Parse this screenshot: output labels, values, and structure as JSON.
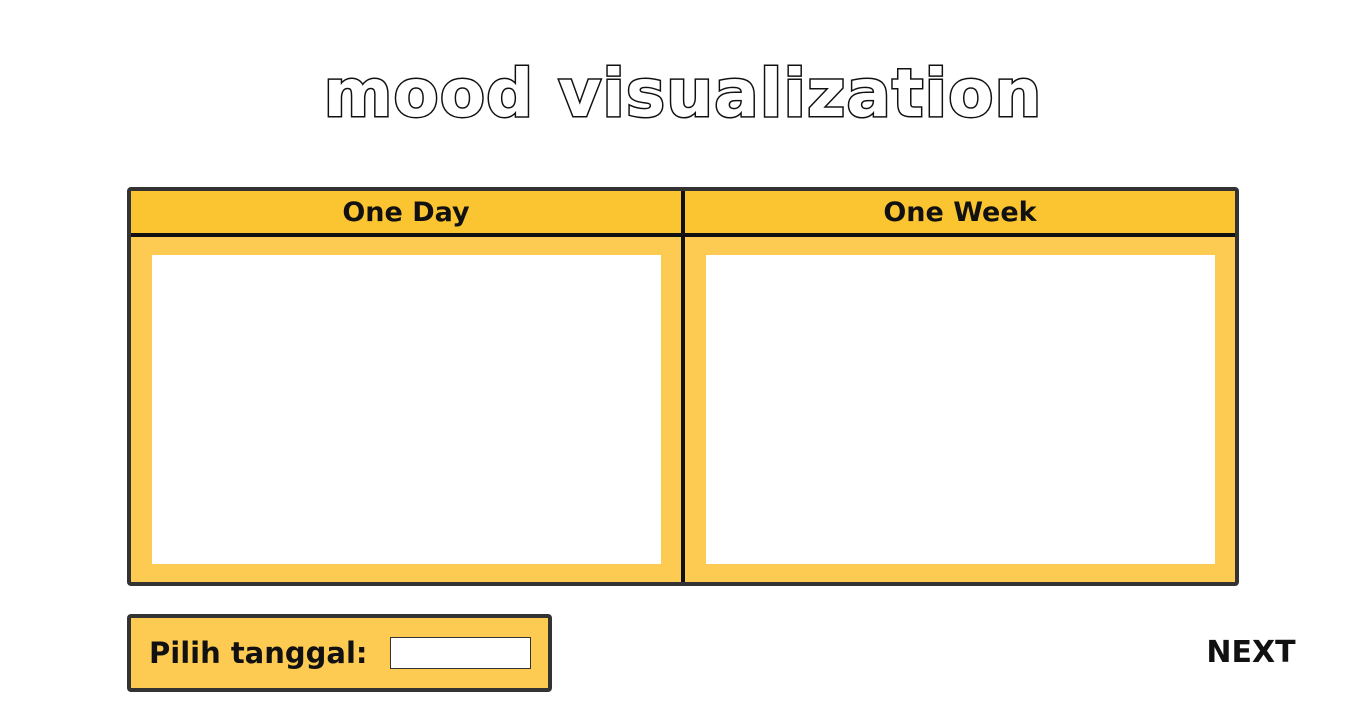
{
  "page": {
    "title": "mood visualization"
  },
  "panels": [
    {
      "label": "One Day"
    },
    {
      "label": "One Week"
    }
  ],
  "date_picker": {
    "label": "Pilih tanggal:",
    "value": ""
  },
  "navigation": {
    "next_label": "NEXT"
  },
  "colors": {
    "header_yellow": "#fbc531",
    "panel_yellow": "#fdcb52",
    "border_dark": "#333333"
  }
}
